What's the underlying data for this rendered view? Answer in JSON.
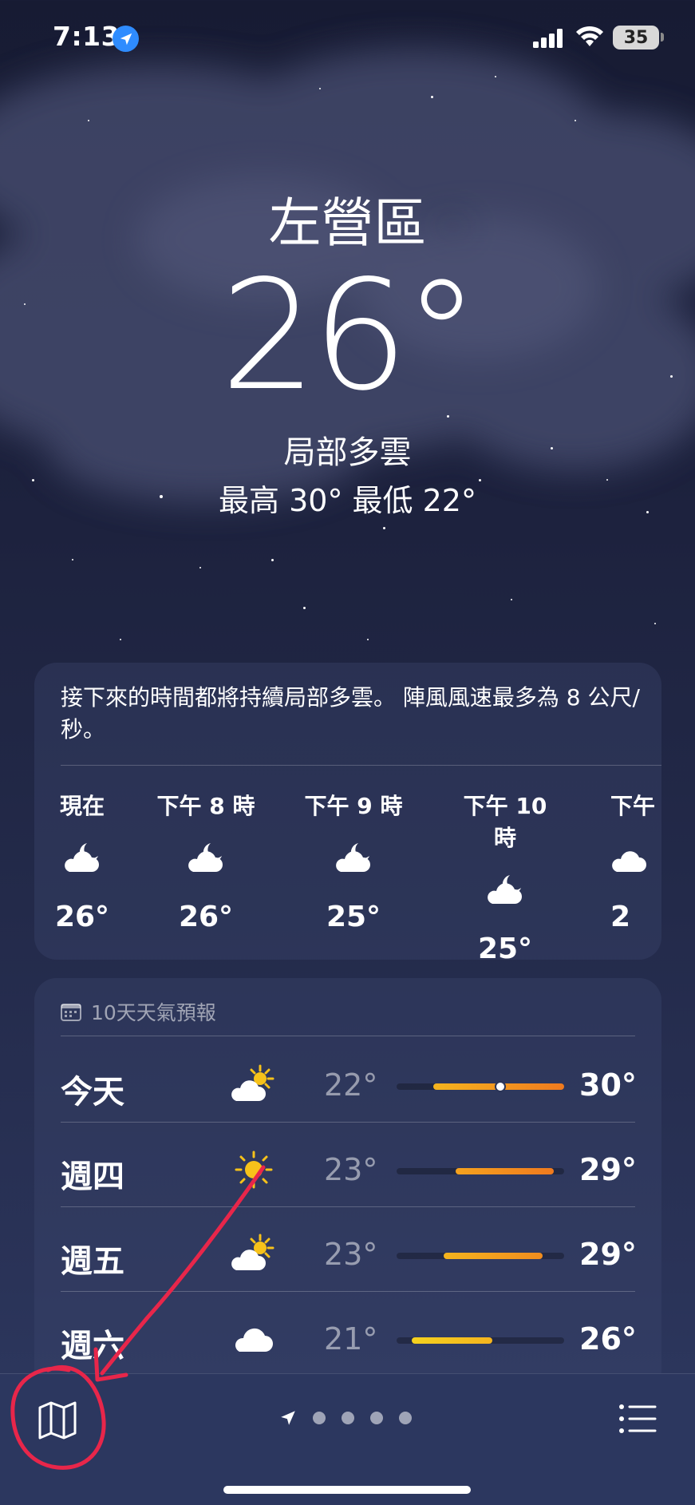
{
  "status": {
    "time": "7:13",
    "battery": "35"
  },
  "header": {
    "city": "左營區",
    "temp": "26°",
    "condition": "局部多雲",
    "hilo": "最高 30°  最低 22°"
  },
  "hourly": {
    "summary": "接下來的時間都將持續局部多雲。 陣風風速最多為 8 公尺/秒。",
    "items": [
      {
        "label": "現在",
        "icon": "cloud-moon-icon",
        "temp": "26°"
      },
      {
        "label": "下午 8 時",
        "icon": "cloud-moon-icon",
        "temp": "26°"
      },
      {
        "label": "下午 9 時",
        "icon": "cloud-moon-icon",
        "temp": "25°"
      },
      {
        "label": "下午 10 時",
        "icon": "cloud-moon-icon",
        "temp": "25°"
      },
      {
        "label": "下午",
        "icon": "cloud-moon-icon",
        "temp": "2"
      }
    ]
  },
  "forecast": {
    "title": "10天天氣預報",
    "days": [
      {
        "day": "今天",
        "icon": "cloud-sun-icon",
        "low": "22°",
        "high": "30°",
        "range_start": 0.22,
        "range_end": 1.0,
        "current": 0.62,
        "colors": [
          "#f5b41e",
          "#f07a1e"
        ]
      },
      {
        "day": "週四",
        "icon": "sun-icon",
        "low": "23°",
        "high": "29°",
        "range_start": 0.35,
        "range_end": 0.94,
        "colors": [
          "#f5a21e",
          "#f07a1e"
        ]
      },
      {
        "day": "週五",
        "icon": "cloud-sun-icon",
        "low": "23°",
        "high": "29°",
        "range_start": 0.28,
        "range_end": 0.87,
        "colors": [
          "#f5b41e",
          "#f08c1e"
        ]
      },
      {
        "day": "週六",
        "icon": "cloud-icon",
        "low": "21°",
        "high": "26°",
        "range_start": 0.09,
        "range_end": 0.57,
        "colors": [
          "#f5d21e",
          "#f5b41e"
        ]
      }
    ]
  },
  "toolbar": {
    "map_icon": "map-icon",
    "list_icon": "list-icon",
    "page_dots": 4
  }
}
